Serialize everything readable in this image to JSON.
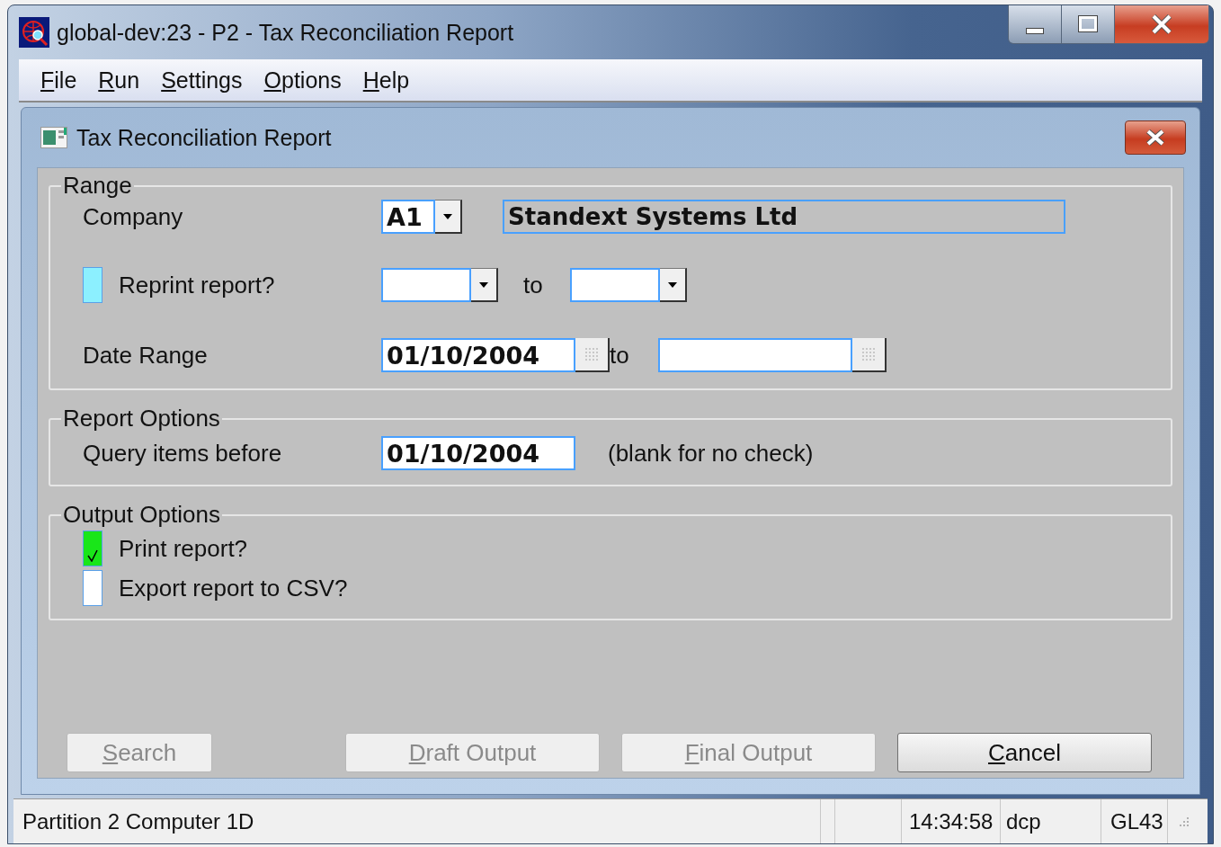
{
  "window": {
    "title": "global-dev:23 - P2 - Tax Reconciliation Report"
  },
  "menu": [
    {
      "label": "File",
      "mnemonic": true
    },
    {
      "label": "Run",
      "mnemonic": true
    },
    {
      "label": "Settings",
      "mnemonic": true
    },
    {
      "label": "Options",
      "mnemonic": true
    },
    {
      "label": "Help",
      "mnemonic": true
    }
  ],
  "dialog": {
    "title": "Tax Reconciliation Report",
    "sections": [
      {
        "title": "Range",
        "rows": [
          {
            "kind": "lookup",
            "label": "Company",
            "code": "A1",
            "name": "Standext Systems Ltd"
          },
          {
            "kind": "check_range",
            "label": "Reprint report?",
            "checked": false,
            "highlighted": true,
            "to_label": "to"
          },
          {
            "kind": "date_range",
            "label": "Date Range",
            "from": "01/10/2004",
            "to_label": "to"
          }
        ]
      },
      {
        "title": "Report Options",
        "rows": [
          {
            "kind": "date_note",
            "label": "Query items before",
            "value": "01/10/2004",
            "note": "(blank for no check)"
          }
        ]
      },
      {
        "title": "Output Options",
        "rows": [
          {
            "kind": "checkbox",
            "label": "Print report?",
            "checked": true,
            "highlighted": false
          },
          {
            "kind": "checkbox",
            "label": "Export report to CSV?",
            "checked": false,
            "highlighted": false
          }
        ]
      }
    ],
    "buttons": [
      {
        "label": "Search",
        "mnemonic": true,
        "disabled": true
      },
      {
        "label": "Draft Output",
        "mnemonic": true,
        "disabled": true
      },
      {
        "label": "Final Output",
        "mnemonic": true,
        "disabled": true
      },
      {
        "label": "Cancel",
        "mnemonic": true,
        "disabled": false
      }
    ]
  },
  "status_bar": {
    "message": "Partition 2 Computer 1D",
    "time": "14:34:58",
    "user": "dcp",
    "program": "GL43"
  }
}
